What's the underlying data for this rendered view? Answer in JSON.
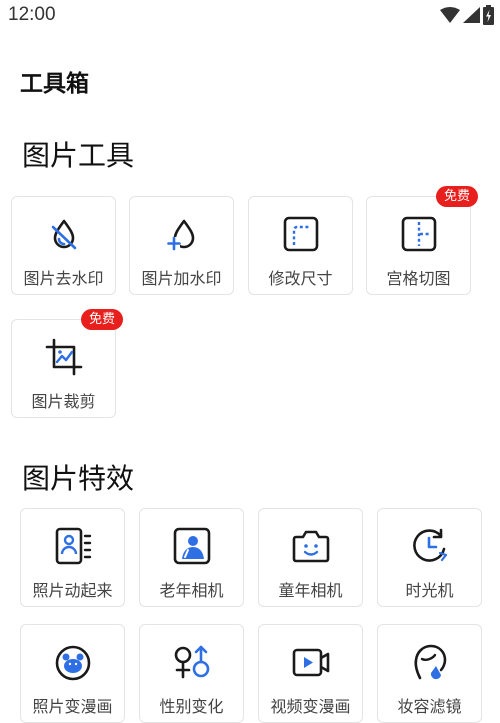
{
  "status_bar": {
    "time": "12:00"
  },
  "app_title": "工具箱",
  "sections": [
    {
      "title": "图片工具",
      "items": [
        {
          "label": "图片去水印",
          "icon": "watermark-remove-icon"
        },
        {
          "label": "图片加水印",
          "icon": "watermark-add-icon"
        },
        {
          "label": "修改尺寸",
          "icon": "resize-icon"
        },
        {
          "label": "宫格切图",
          "icon": "grid-cut-icon",
          "badge": "免费"
        },
        {
          "label": "图片裁剪",
          "icon": "crop-icon",
          "badge": "免费"
        }
      ]
    },
    {
      "title": "图片特效",
      "items": [
        {
          "label": "照片动起来",
          "icon": "photo-animate-icon"
        },
        {
          "label": "老年相机",
          "icon": "old-age-camera-icon"
        },
        {
          "label": "童年相机",
          "icon": "child-camera-icon"
        },
        {
          "label": "时光机",
          "icon": "time-machine-icon"
        },
        {
          "label": "照片变漫画",
          "icon": "cartoon-icon"
        },
        {
          "label": "性别变化",
          "icon": "gender-swap-icon"
        },
        {
          "label": "视频变漫画",
          "icon": "video-cartoon-icon"
        },
        {
          "label": "妆容滤镜",
          "icon": "makeup-filter-icon"
        }
      ]
    }
  ],
  "colors": {
    "accent": "#2f6fe4",
    "icon_dark": "#1a1a1a",
    "badge": "#e8201d"
  }
}
